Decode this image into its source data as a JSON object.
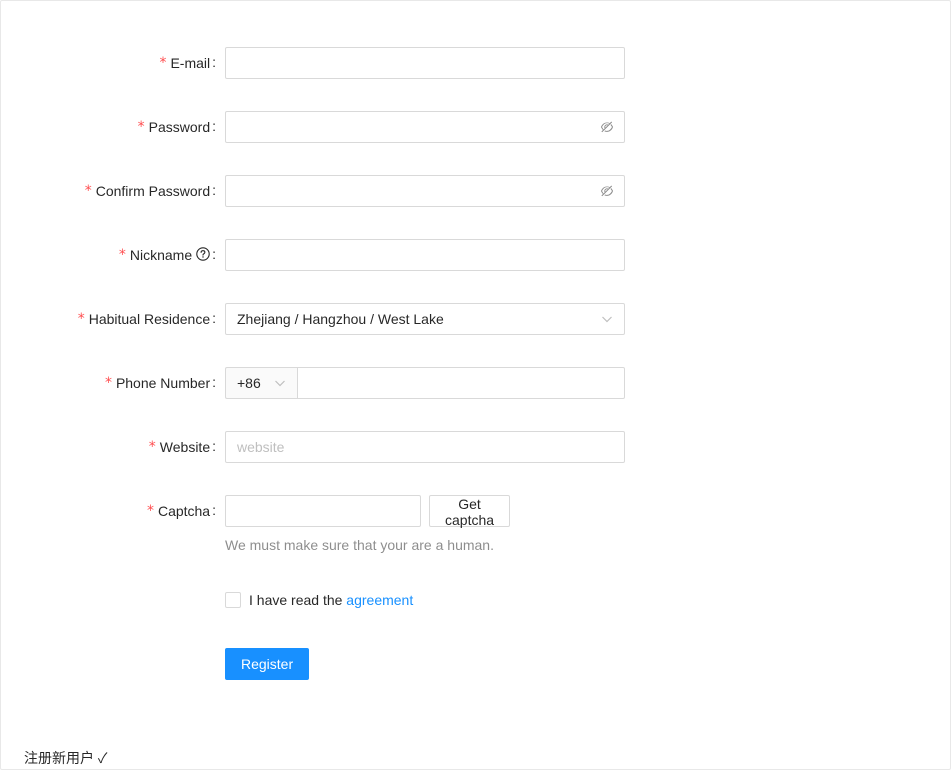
{
  "form": {
    "email": {
      "label": "E-mail",
      "value": "",
      "placeholder": ""
    },
    "password": {
      "label": "Password",
      "value": "",
      "placeholder": ""
    },
    "confirm_password": {
      "label": "Confirm Password",
      "value": "",
      "placeholder": ""
    },
    "nickname": {
      "label": "Nickname",
      "value": "",
      "placeholder": ""
    },
    "residence": {
      "label": "Habitual Residence",
      "value": "Zhejiang / Hangzhou / West Lake"
    },
    "phone": {
      "label": "Phone Number",
      "prefix": "+86",
      "value": "",
      "placeholder": ""
    },
    "website": {
      "label": "Website",
      "value": "",
      "placeholder": "website"
    },
    "captcha": {
      "label": "Captcha",
      "value": "",
      "button_label": "Get captcha",
      "extra": "We must make sure that your are a human."
    },
    "agreement": {
      "text": "I have read the",
      "link_text": "agreement",
      "checked": false
    },
    "register_label": "Register",
    "required_mark": "*",
    "colon": ":"
  },
  "footer": {
    "title": "注册新用户 ✓"
  },
  "colors": {
    "primary": "#1890ff",
    "required": "#ff4d4f",
    "border": "#d9d9d9",
    "placeholder": "#bfbfbf"
  },
  "icons": {
    "password_toggle": "eye-invisible-icon",
    "help": "question-circle-icon",
    "select_arrow": "chevron-down-icon"
  }
}
